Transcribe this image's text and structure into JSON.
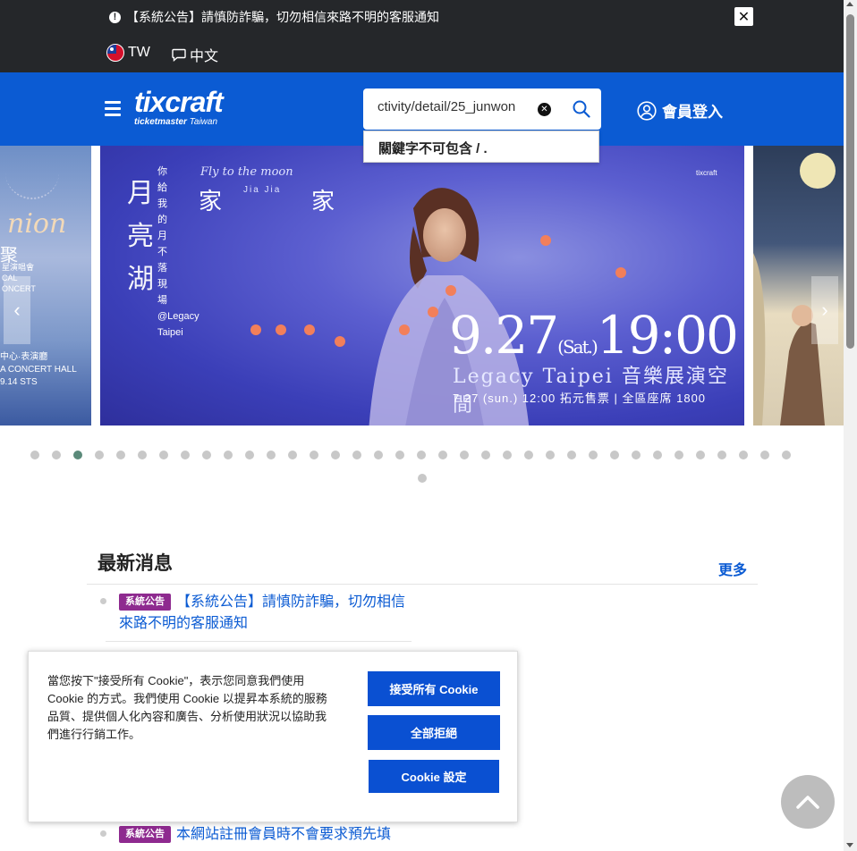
{
  "topbar": {
    "notice": "【系統公告】請慎防詐騙，切勿相信來路不明的客服通知",
    "close_label": "✕",
    "region": "TW",
    "language": "中文"
  },
  "header": {
    "logo_word": "tixcraft",
    "logo_sub_brand": "ticketmaster",
    "logo_sub_region": "Taiwan",
    "search_value": "ctivity/detail/25_junwon",
    "search_error": "關鍵字不可包含 / .",
    "login_label": "會員登入"
  },
  "carousel": {
    "left_slide": {
      "title": "nion",
      "subtitle": "聚",
      "line1": "星演唱會",
      "line2": "CAL",
      "line3": "ONCERT",
      "venue": "中心·表演廳",
      "venue_en": "A CONCERT HALL",
      "date": "9.14",
      "brand": "STS"
    },
    "main_slide": {
      "vertical_title": "月亮湖",
      "vertical_subtitle": "你給我的月不落現場@Legacy Taipei",
      "fly": "Fly to the moon",
      "artist_en": "Jia Jia",
      "artist_char_1": "家",
      "artist_char_2": "家",
      "date": "9.27",
      "day": "(Sat.)",
      "time": "19:00",
      "venue": "Legacy Taipei 音樂展演空間",
      "sale": "7.27 (sun.) 12:00 拓元售票 | 全區座席 1800",
      "logos": "tixcraft"
    },
    "prev_label": "‹",
    "next_label": "›",
    "dot_count": 37,
    "active_dot": 2
  },
  "news": {
    "title": "最新消息",
    "more": "更多",
    "items": [
      {
        "tag": "系統公告",
        "text": "【系統公告】請慎防詐騙，切勿相信來路不明的客服通知"
      },
      {
        "tag": "系統公告",
        "text": "本網站註冊會員時不會要求預先填"
      }
    ]
  },
  "cookie": {
    "message": "當您按下\"接受所有 Cookie\"，表示您同意我們使用 Cookie 的方式。我們使用 Cookie 以提昇本系統的服務品質、提供個人化內容和廣告、分析使用狀況以協助我們進行行銷工作。",
    "accept": "接受所有 Cookie",
    "reject": "全部拒絕",
    "settings": "Cookie 設定"
  },
  "colors": {
    "brand_blue": "#0b5bd3",
    "topbar": "#25272a",
    "tag_purple": "#8e2a8f",
    "cookie_button": "#0a50d2"
  },
  "icons": {
    "close": "close-icon",
    "flag": "taiwan-flag-icon",
    "language": "chat-bubble-icon",
    "menu": "hamburger-menu-icon",
    "search": "search-icon",
    "clear": "clear-circle-icon",
    "user": "user-circle-icon",
    "back_to_top": "chevron-up-icon"
  }
}
